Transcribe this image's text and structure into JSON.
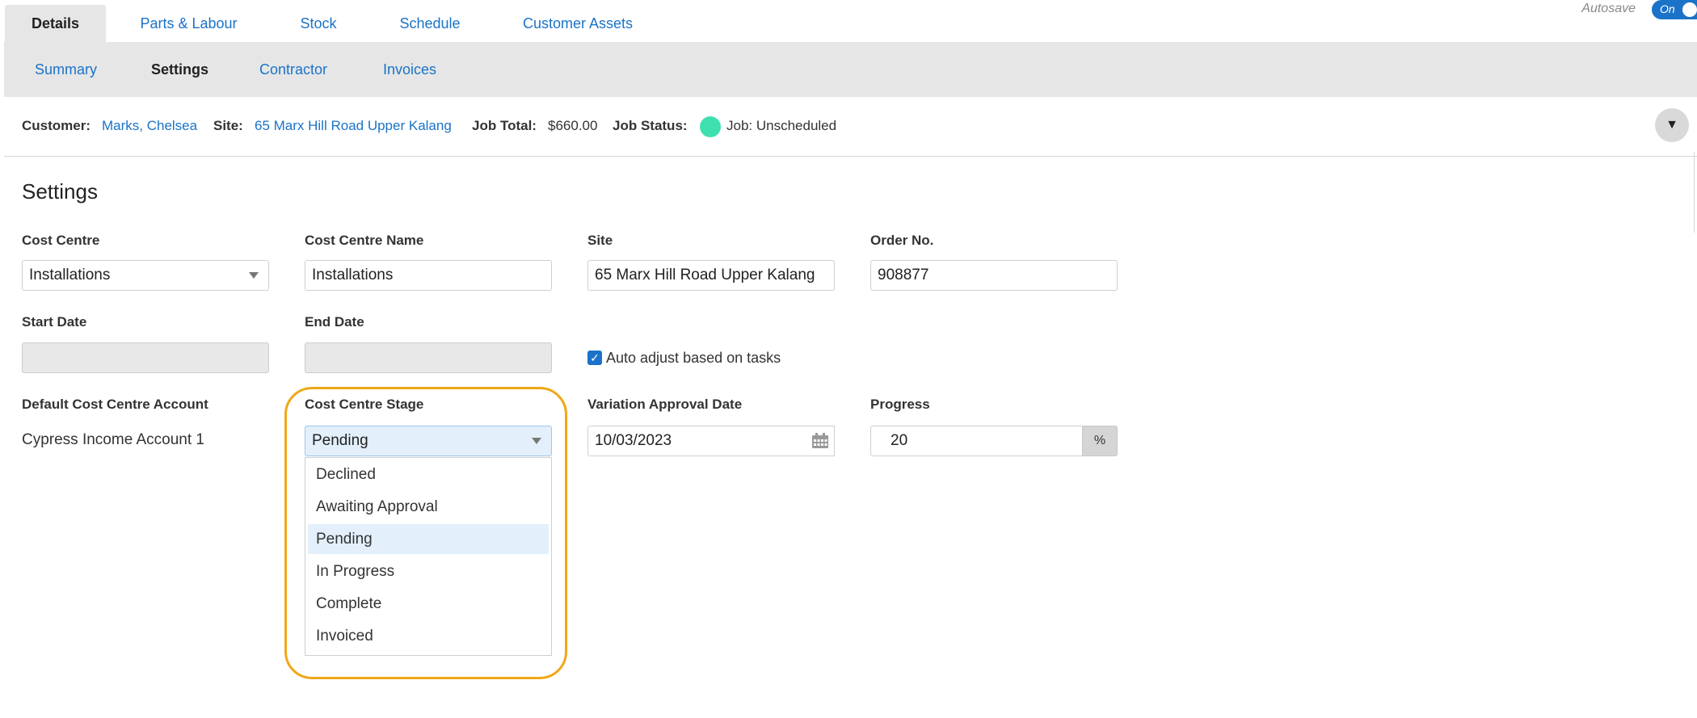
{
  "top_tabs": [
    {
      "label": "Details",
      "active": true
    },
    {
      "label": "Parts & Labour",
      "active": false
    },
    {
      "label": "Stock",
      "active": false
    },
    {
      "label": "Schedule",
      "active": false
    },
    {
      "label": "Customer Assets",
      "active": false
    }
  ],
  "autosave": {
    "label": "Autosave",
    "toggle_text": "On",
    "on": true
  },
  "sub_tabs": [
    {
      "label": "Summary",
      "active": false
    },
    {
      "label": "Settings",
      "active": true
    },
    {
      "label": "Contractor",
      "active": false
    },
    {
      "label": "Invoices",
      "active": false
    }
  ],
  "info_bar": {
    "customer_label": "Customer:",
    "customer_value": "Marks, Chelsea",
    "site_label": "Site:",
    "site_value": "65 Marx Hill Road Upper Kalang",
    "job_total_label": "Job Total:",
    "job_total_value": "$660.00",
    "job_status_label": "Job Status:",
    "job_status_value": "Job: Unscheduled",
    "status_color": "#3fe0b0",
    "collapse_icon": "chevron-down-icon"
  },
  "section_title": "Settings",
  "form": {
    "cost_centre": {
      "label": "Cost Centre",
      "value": "Installations"
    },
    "cost_centre_name": {
      "label": "Cost Centre Name",
      "value": "Installations"
    },
    "site": {
      "label": "Site",
      "value": "65 Marx Hill Road Upper Kalang"
    },
    "order_no": {
      "label": "Order No.",
      "value": "908877"
    },
    "start_date": {
      "label": "Start Date",
      "value": ""
    },
    "end_date": {
      "label": "End Date",
      "value": ""
    },
    "auto_adjust": {
      "label": "Auto adjust based on tasks",
      "checked": true
    },
    "default_account": {
      "label": "Default Cost Centre Account",
      "value": "Cypress Income Account 1"
    },
    "stage": {
      "label": "Cost Centre Stage",
      "value": "Pending",
      "options": [
        "Declined",
        "Awaiting Approval",
        "Pending",
        "In Progress",
        "Complete",
        "Invoiced"
      ],
      "selected_index": 2
    },
    "variation_date": {
      "label": "Variation Approval Date",
      "value": "10/03/2023"
    },
    "progress": {
      "label": "Progress",
      "value": "20",
      "unit": "%"
    }
  },
  "colors": {
    "accent": "#1a73c8",
    "highlight": "#f0a818",
    "selected_option": "#e3f0fc"
  }
}
